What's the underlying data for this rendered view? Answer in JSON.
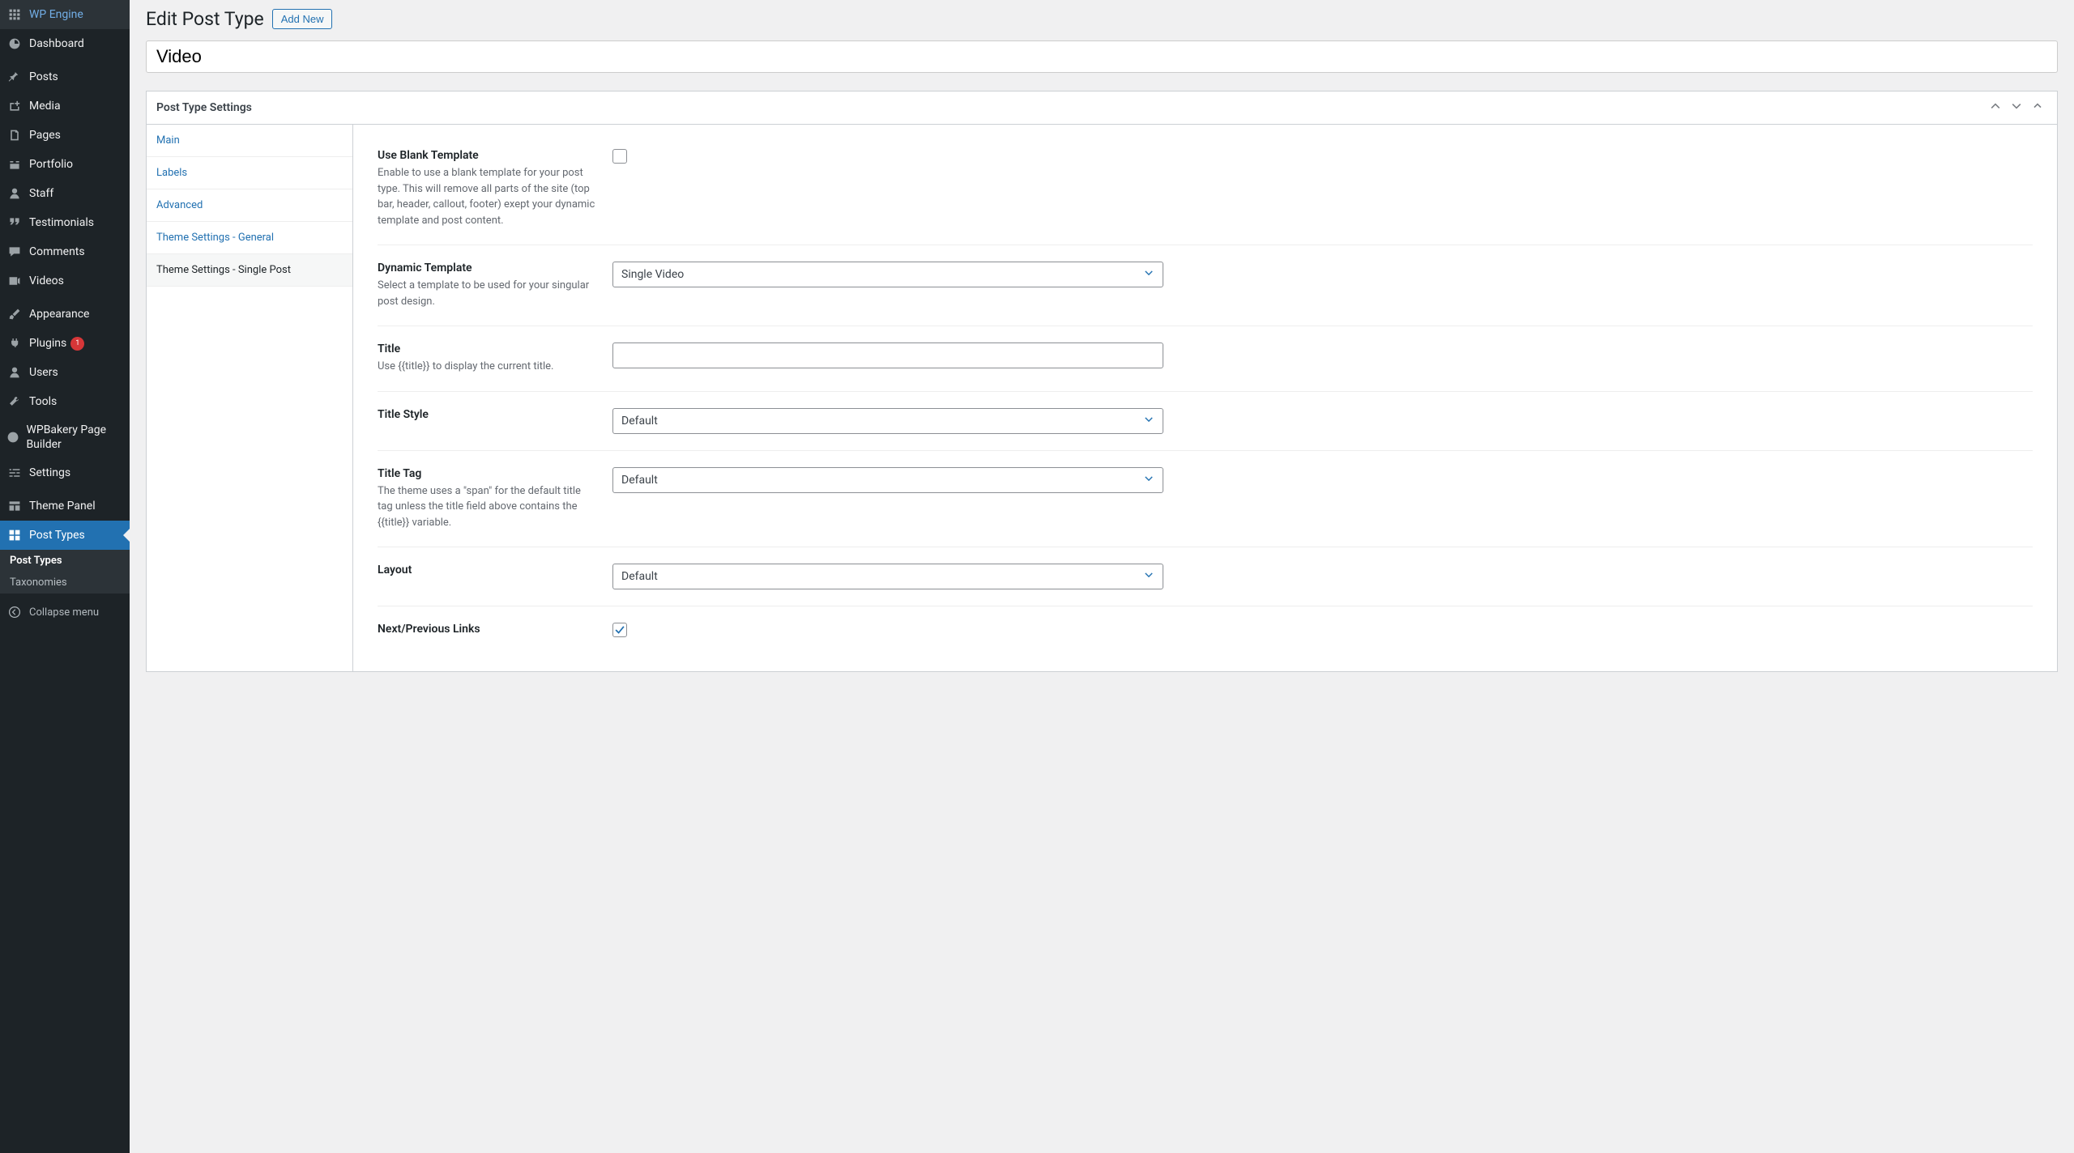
{
  "sidebar": {
    "items": [
      {
        "label": "WP Engine",
        "icon": "gear"
      },
      {
        "label": "Dashboard",
        "icon": "dashboard"
      },
      {
        "label": "Posts",
        "icon": "pin"
      },
      {
        "label": "Media",
        "icon": "media"
      },
      {
        "label": "Pages",
        "icon": "page"
      },
      {
        "label": "Portfolio",
        "icon": "portfolio"
      },
      {
        "label": "Staff",
        "icon": "user"
      },
      {
        "label": "Testimonials",
        "icon": "quote"
      },
      {
        "label": "Comments",
        "icon": "comment"
      },
      {
        "label": "Videos",
        "icon": "video"
      },
      {
        "label": "Appearance",
        "icon": "brush"
      },
      {
        "label": "Plugins",
        "icon": "plug",
        "badge": "1"
      },
      {
        "label": "Users",
        "icon": "user"
      },
      {
        "label": "Tools",
        "icon": "wrench"
      },
      {
        "label": "WPBakery Page Builder",
        "icon": "wpb"
      },
      {
        "label": "Settings",
        "icon": "sliders"
      },
      {
        "label": "Theme Panel",
        "icon": "layout"
      },
      {
        "label": "Post Types",
        "icon": "grid",
        "active": true
      }
    ],
    "submenu": [
      {
        "label": "Post Types",
        "active": true
      },
      {
        "label": "Taxonomies"
      }
    ],
    "collapse": "Collapse menu"
  },
  "header": {
    "title": "Edit Post Type",
    "add_new": "Add New"
  },
  "title_input": "Video",
  "panel": {
    "title": "Post Type Settings"
  },
  "tabs": [
    {
      "label": "Main"
    },
    {
      "label": "Labels"
    },
    {
      "label": "Advanced"
    },
    {
      "label": "Theme Settings - General"
    },
    {
      "label": "Theme Settings - Single Post",
      "active": true
    }
  ],
  "form": {
    "blank_template": {
      "title": "Use Blank Template",
      "desc": "Enable to use a blank template for your post type. This will remove all parts of the site (top bar, header, callout, footer) exept your dynamic template and post content.",
      "checked": false
    },
    "dynamic_template": {
      "title": "Dynamic Template",
      "desc": "Select a template to be used for your singular post design.",
      "value": "Single Video"
    },
    "title": {
      "title": "Title",
      "desc": "Use {{title}} to display the current title.",
      "value": ""
    },
    "title_style": {
      "title": "Title Style",
      "value": "Default"
    },
    "title_tag": {
      "title": "Title Tag",
      "desc": "The theme uses a \"span\" for the default title tag unless the title field above contains the {{title}} variable.",
      "value": "Default"
    },
    "layout": {
      "title": "Layout",
      "value": "Default"
    },
    "next_prev": {
      "title": "Next/Previous Links",
      "checked": true
    }
  }
}
